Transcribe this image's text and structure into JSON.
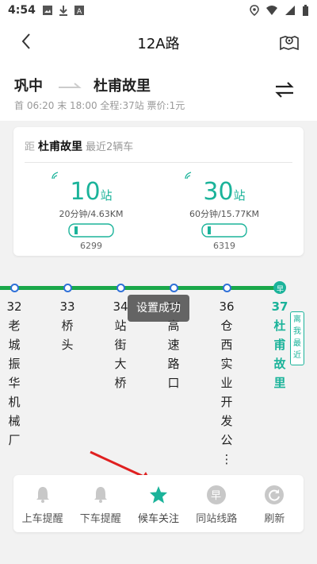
{
  "status_bar": {
    "time": "4:54"
  },
  "header": {
    "title": "12A路"
  },
  "route": {
    "from": "巩中",
    "to": "杜甫故里",
    "info": "首 06:20 末 18:00 全程:37站 票价:1元"
  },
  "arrival_card": {
    "prefix": "距",
    "destination": "杜甫故里",
    "nearest": "最近2辆车",
    "buses": [
      {
        "stops": "10",
        "unit": "站",
        "detail": "20分钟/4.63KM",
        "plate": "6299"
      },
      {
        "stops": "30",
        "unit": "站",
        "detail": "60分钟/15.77KM",
        "plate": "6319"
      }
    ]
  },
  "stations": [
    {
      "label": "32\n老\n城\n振\n华\n机\n械\n厂"
    },
    {
      "label": "33\n桥\n头"
    },
    {
      "label": "34\n站\n街\n大\n桥"
    },
    {
      "label": "35\n高\n速\n路\n口"
    },
    {
      "label": "36\n仓\n西\n实\n业\n开\n发\n公\n⋮"
    },
    {
      "label": "37\n杜\n甫\n故\n里",
      "current": true,
      "badge": "早"
    }
  ],
  "near_me": "离\n我\n最\n近",
  "toast": "设置成功",
  "toolbar": [
    {
      "label": "上车提醒",
      "icon": "bell-icon"
    },
    {
      "label": "下车提醒",
      "icon": "bell-icon"
    },
    {
      "label": "候车关注",
      "icon": "star-icon"
    },
    {
      "label": "同站线路",
      "icon": "same-station-icon"
    },
    {
      "label": "刷新",
      "icon": "refresh-icon"
    }
  ],
  "colors": {
    "accent": "#1bb39a",
    "track": "#1aa84a",
    "station_ring": "#2f70d8",
    "annotation": "#e02020"
  }
}
